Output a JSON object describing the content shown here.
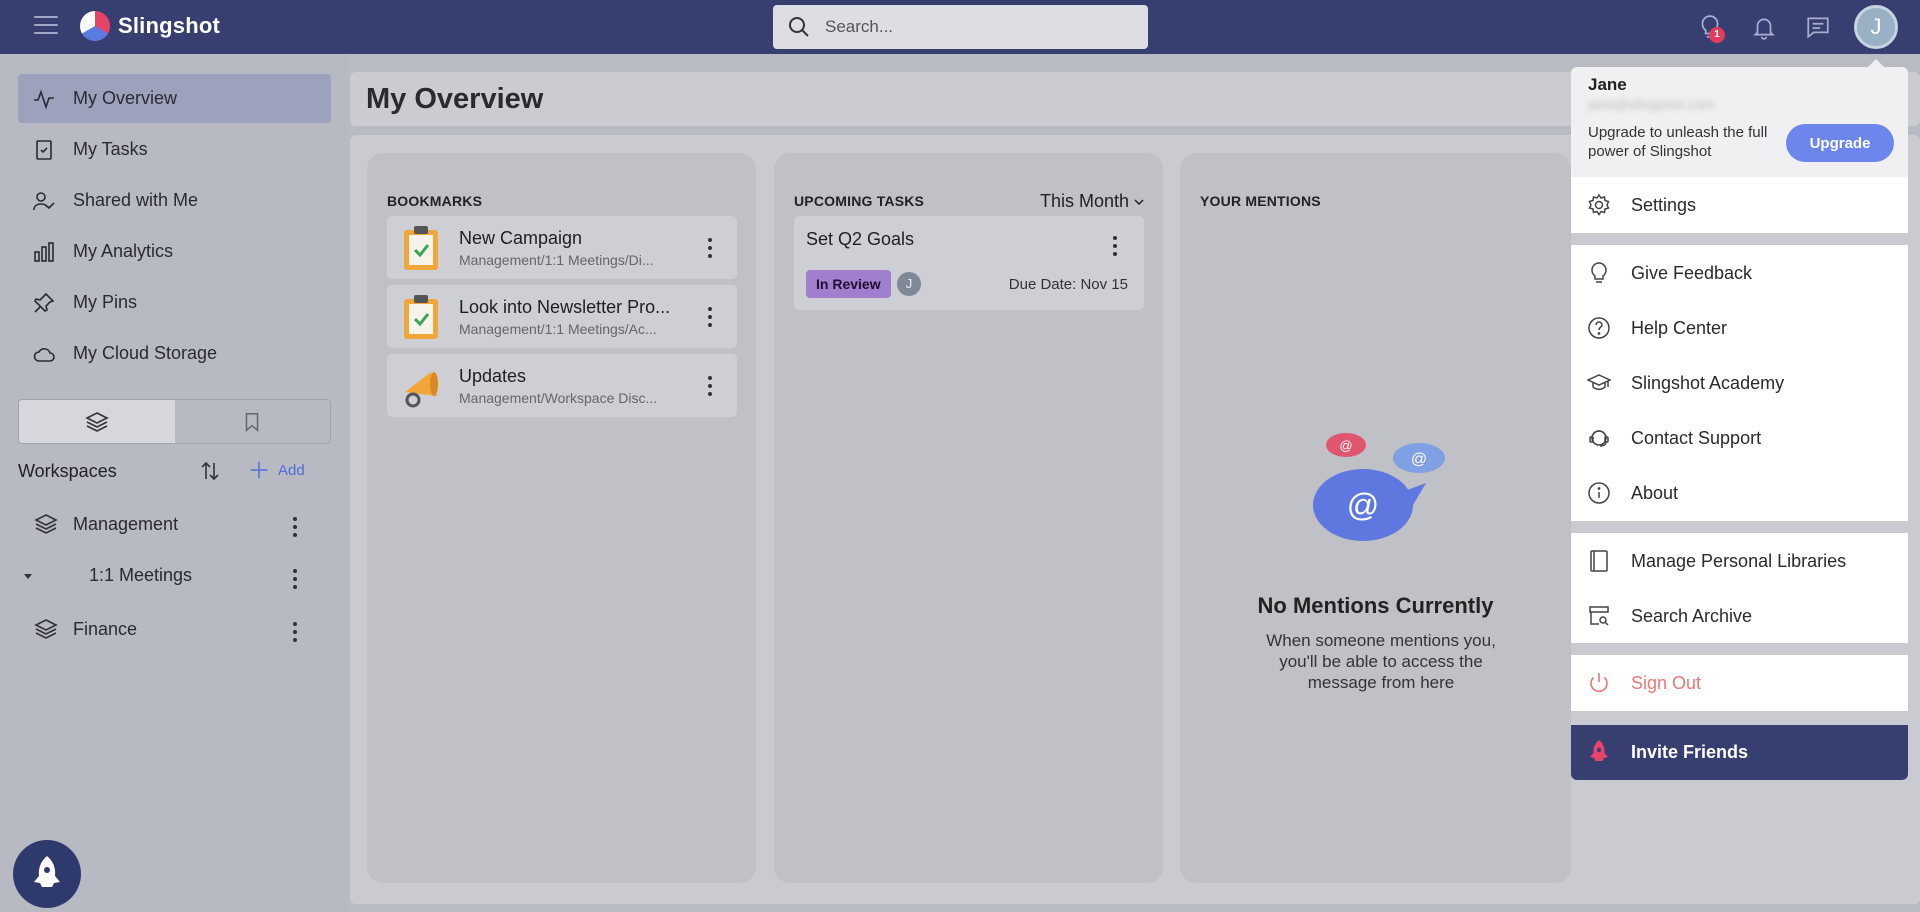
{
  "app": {
    "name": "Slingshot"
  },
  "search": {
    "placeholder": "Search..."
  },
  "topbar": {
    "notification_badge": "1",
    "avatar_initial": "J"
  },
  "sidebar": {
    "nav": [
      {
        "label": "My Overview"
      },
      {
        "label": "My Tasks"
      },
      {
        "label": "Shared with Me"
      },
      {
        "label": "My Analytics"
      },
      {
        "label": "My Pins"
      },
      {
        "label": "My Cloud Storage"
      }
    ],
    "workspaces_title": "Workspaces",
    "add_label": "Add",
    "workspaces": [
      {
        "label": "Management"
      },
      {
        "label": "1:1 Meetings"
      },
      {
        "label": "Finance"
      }
    ]
  },
  "page": {
    "title": "My Overview"
  },
  "bookmarks": {
    "title": "BOOKMARKS",
    "items": [
      {
        "name": "New Campaign",
        "path": "Management/1:1 Meetings/Di..."
      },
      {
        "name": "Look into Newsletter Pro...",
        "path": "Management/1:1 Meetings/Ac..."
      },
      {
        "name": "Updates",
        "path": "Management/Workspace Disc..."
      }
    ]
  },
  "tasks": {
    "title": "UPCOMING TASKS",
    "filter": "This Month",
    "items": [
      {
        "name": "Set Q2 Goals",
        "status": "In Review",
        "assignee": "J",
        "due": "Due Date:  Nov 15"
      }
    ]
  },
  "mentions": {
    "title": "YOUR MENTIONS",
    "empty_title": "No Mentions Currently",
    "empty_text": "When someone mentions you, you'll be able to access the message from here"
  },
  "menu": {
    "user_name": "Jane",
    "user_email": "jane@slingshot.com",
    "upgrade_text": "Upgrade to unleash the full power of Slingshot",
    "upgrade_button": "Upgrade",
    "settings": "Settings",
    "give_feedback": "Give Feedback",
    "help_center": "Help Center",
    "academy": "Slingshot Academy",
    "contact_support": "Contact Support",
    "about": "About",
    "manage_libraries": "Manage Personal Libraries",
    "search_archive": "Search Archive",
    "sign_out": "Sign Out",
    "invite_friends": "Invite Friends"
  },
  "colors": {
    "topbar": "#363f70",
    "accent": "#6d86ee",
    "sign_out": "#ea7877",
    "status_in_review": "#a07fcf"
  }
}
